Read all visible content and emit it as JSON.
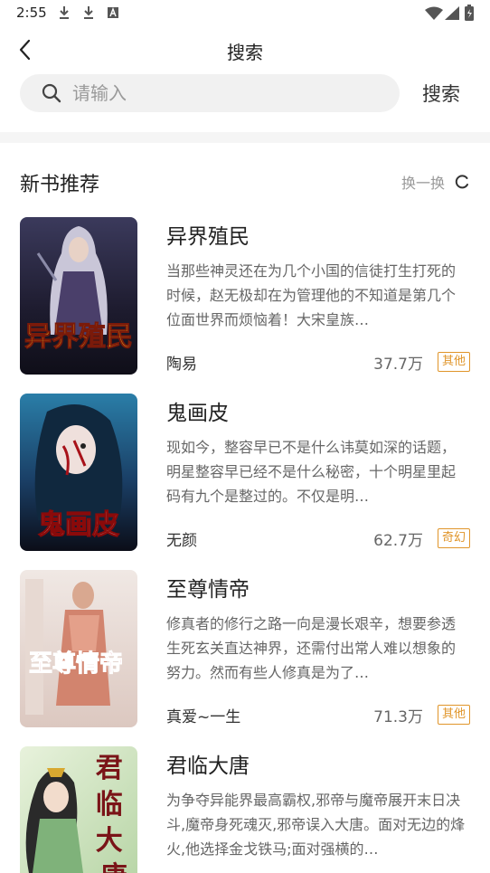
{
  "status": {
    "time": "2:55"
  },
  "header": {
    "title": "搜索"
  },
  "search": {
    "placeholder": "请输入",
    "value": "",
    "button": "搜索"
  },
  "section": {
    "title": "新书推荐",
    "refresh_label": "换一换"
  },
  "books": [
    {
      "title": "异界殖民",
      "desc": "当那些神灵还在为几个小国的信徒打生打死的时候，赵无极却在为管理他的不知道是第几个位面世界而烦恼着！大宋皇族…",
      "author": "陶易",
      "count": "37.7万",
      "tag": "其他",
      "cover_text": "异界殖民"
    },
    {
      "title": "鬼画皮",
      "desc": "现如今，整容早已不是什么讳莫如深的话题，明星整容早已经不是什么秘密，十个明星里起码有九个是整过的。不仅是明…",
      "author": "无颜",
      "count": "62.7万",
      "tag": "奇幻",
      "cover_text": "鬼画皮"
    },
    {
      "title": "至尊情帝",
      "desc": "修真者的修行之路一向是漫长艰辛，想要参透生死玄关直达神界，还需付出常人难以想象的努力。然而有些人修真是为了…",
      "author": "真爱~一生",
      "count": "71.3万",
      "tag": "其他",
      "cover_text": "至尊情帝"
    },
    {
      "title": "君临大唐",
      "desc": "为争夺异能界最高霸权,邪帝与魔帝展开末日决斗,魔帝身死魂灭,邪帝误入大唐。面对无边的烽火,他选择金戈铁马;面对强横的…",
      "author": "",
      "count": "",
      "tag": "",
      "cover_text": "君临大唐"
    }
  ]
}
